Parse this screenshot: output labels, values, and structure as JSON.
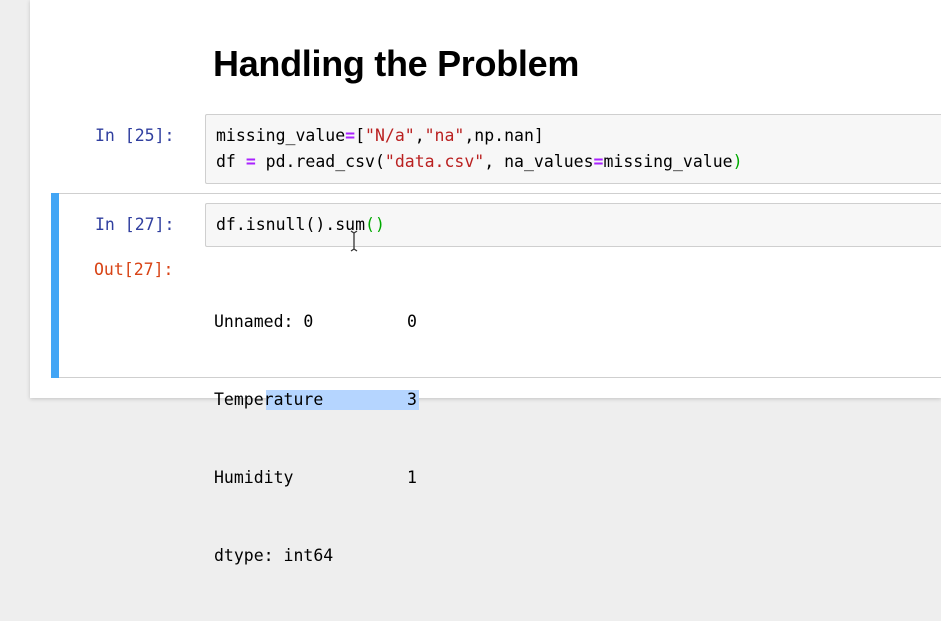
{
  "heading": "Handling the Problem",
  "cells": [
    {
      "prompt": "In [25]:",
      "code_lines": [
        [
          "missing_value",
          "=",
          "[",
          "\"N/a\"",
          ",",
          "\"na\"",
          ",np.nan]"
        ],
        [
          "df ",
          "=",
          " pd.read_csv(",
          "\"data.csv\"",
          ", na_values",
          "=",
          "missing_value",
          ")"
        ]
      ]
    },
    {
      "prompt": "In [27]:",
      "code": [
        "df.isnull(",
        ")",
        ".sum",
        "()"
      ],
      "out_prompt": "Out[27]:",
      "output": [
        {
          "name": "Unnamed: 0",
          "value": "0"
        },
        {
          "name": "Temp",
          "name_selected": "erature",
          "value": "3"
        },
        {
          "name": "Humidity",
          "value": "1"
        },
        {
          "name": "dtype: int64",
          "value": ""
        }
      ]
    }
  ]
}
